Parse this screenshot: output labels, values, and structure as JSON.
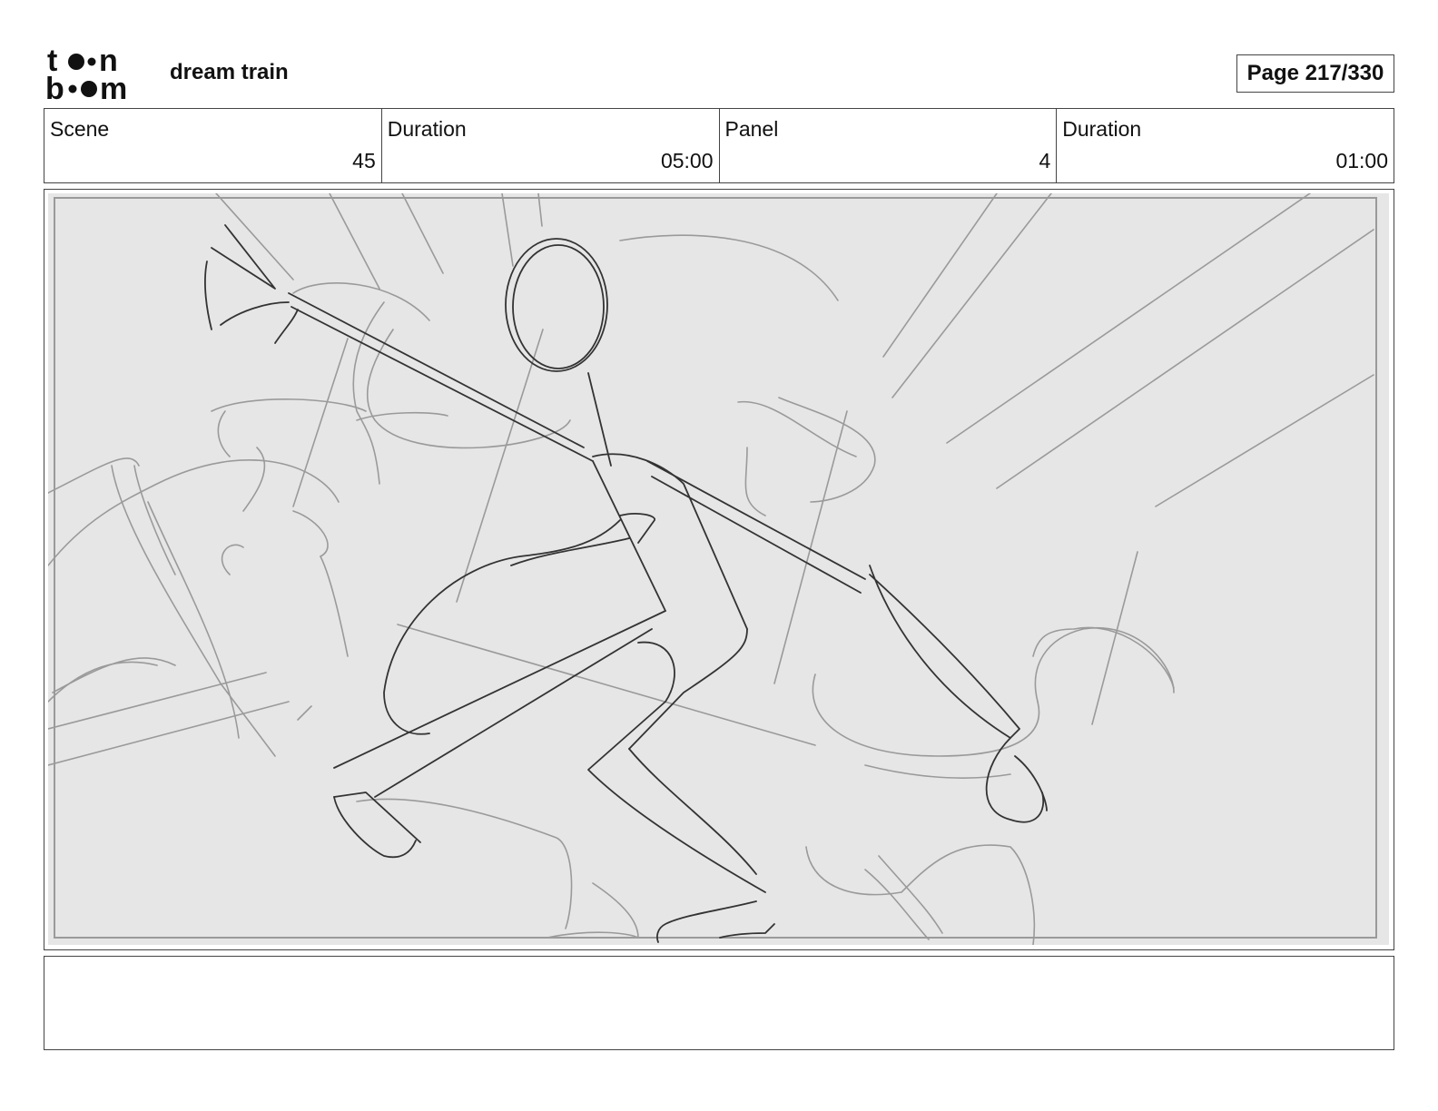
{
  "header": {
    "logo_icon": "toon-boom-logo",
    "project_title": "dream train",
    "page_indicator": "Page 217/330"
  },
  "info_table": {
    "cells": [
      {
        "label": "Scene",
        "value": "45"
      },
      {
        "label": "Duration",
        "value": "05:00"
      },
      {
        "label": "Panel",
        "value": "4"
      },
      {
        "label": "Duration",
        "value": "01:00"
      }
    ]
  },
  "panel": {
    "image_icon": "storyboard-sketch",
    "background_color": "#e6e6e6",
    "sketch_color_dark": "#333333",
    "sketch_color_light": "#9a9a9a"
  },
  "notes": {
    "text": ""
  }
}
